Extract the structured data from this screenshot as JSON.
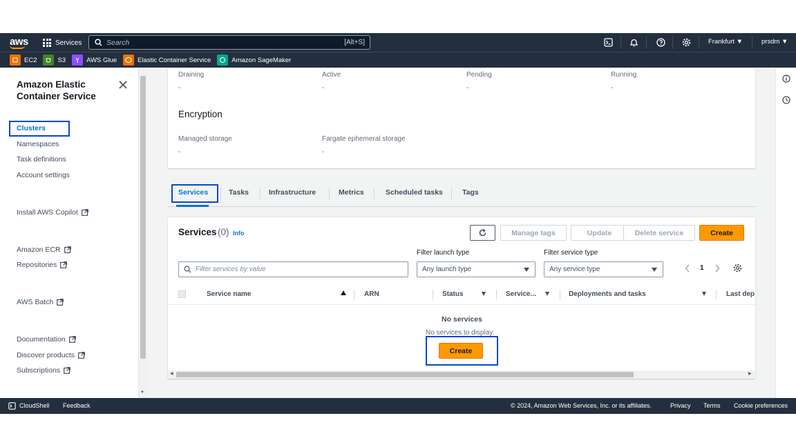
{
  "topnav": {
    "logo": "aws",
    "services_label": "Services",
    "search_placeholder": "Search",
    "search_shortcut": "[Alt+S]",
    "region": "Frankfurt",
    "user": "prsdm"
  },
  "favorites": [
    {
      "label": "EC2",
      "color": "#ed7100"
    },
    {
      "label": "S3",
      "color": "#3f8624"
    },
    {
      "label": "AWS Glue",
      "color": "#8c4fff"
    },
    {
      "label": "Elastic Container Service",
      "color": "#ed7100"
    },
    {
      "label": "Amazon SageMaker",
      "color": "#01a88d"
    }
  ],
  "sidenav": {
    "title": "Amazon Elastic Container Service",
    "items": [
      {
        "label": "Clusters",
        "active": true
      },
      {
        "label": "Namespaces"
      },
      {
        "label": "Task definitions"
      },
      {
        "label": "Account settings"
      }
    ],
    "external_links": [
      {
        "label": "Install AWS Copilot"
      },
      {
        "label": "Amazon ECR"
      },
      {
        "label": "Repositories"
      },
      {
        "label": "AWS Batch"
      },
      {
        "label": "Documentation"
      },
      {
        "label": "Discover products"
      },
      {
        "label": "Subscriptions"
      }
    ]
  },
  "overview": {
    "stats": [
      {
        "label": "Draining",
        "value": "-"
      },
      {
        "label": "Active",
        "value": "-"
      },
      {
        "label": "Pending",
        "value": "-"
      },
      {
        "label": "Running",
        "value": "-"
      }
    ],
    "encryption": {
      "heading": "Encryption",
      "fields": [
        {
          "label": "Managed storage",
          "value": "-"
        },
        {
          "label": "Fargate ephemeral storage",
          "value": "-"
        }
      ]
    }
  },
  "tabs": [
    "Services",
    "Tasks",
    "Infrastructure",
    "Metrics",
    "Scheduled tasks",
    "Tags"
  ],
  "services_panel": {
    "title": "Services",
    "count": "(0)",
    "info": "Info",
    "buttons": {
      "manage_tags": "Manage tags",
      "update": "Update",
      "delete": "Delete service",
      "create": "Create"
    },
    "filter_placeholder": "Filter services by value",
    "filter_launch_label": "Filter launch type",
    "filter_launch_value": "Any launch type",
    "filter_service_label": "Filter service type",
    "filter_service_value": "Any service type",
    "page": "1",
    "columns": [
      "Service name",
      "ARN",
      "Status",
      "Service...",
      "Deployments and tasks",
      "Last dep"
    ],
    "empty_title": "No services",
    "empty_text": "No services to display.",
    "empty_create": "Create"
  },
  "footer": {
    "cloudshell": "CloudShell",
    "feedback": "Feedback",
    "copyright": "© 2024, Amazon Web Services, Inc. or its affiliates.",
    "privacy": "Privacy",
    "terms": "Terms",
    "cookies": "Cookie preferences"
  },
  "colors": {
    "nav_bg": "#232f3e",
    "accent": "#0972d3",
    "primary": "#ff9900",
    "highlight": "#0a45d4"
  }
}
